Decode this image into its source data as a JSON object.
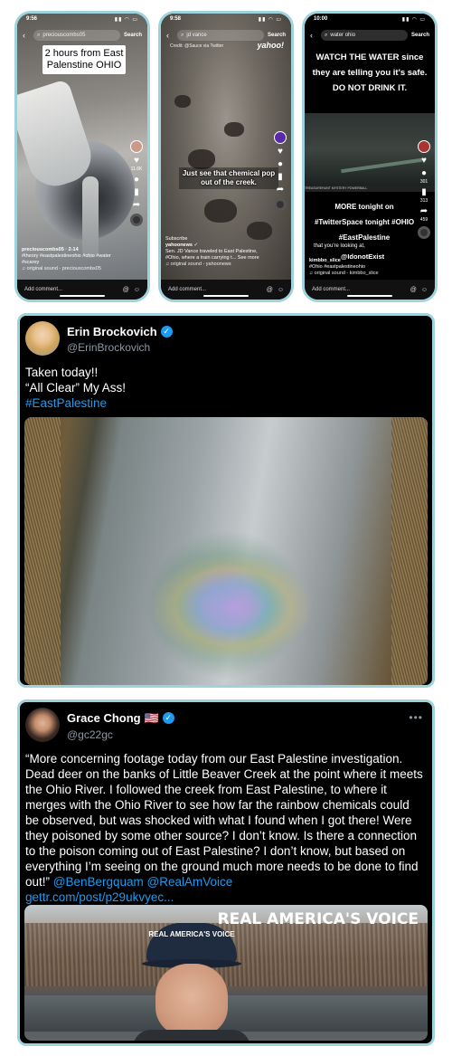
{
  "phones": [
    {
      "time": "9:56",
      "search": {
        "query": "preciouscombs05",
        "button": "Search"
      },
      "caption": "2 hours from East Palenstine OHIO",
      "likes": "11.6K",
      "meta": {
        "user": "preciouscombs05 · 2-14",
        "tags": "#theory #eastpalestineohio #ohio #water #scarey",
        "sound": "♫ original sound - preciouscombs05"
      },
      "comment_placeholder": "Add comment..."
    },
    {
      "time": "9:58",
      "search": {
        "query": "jd vance",
        "button": "Search"
      },
      "sub": "Credit: @Sauce via Twitter",
      "brand": "yahoo!",
      "caption": "Just see that chemical pop out of the creek.",
      "meta": {
        "subscribe": "Subscribe",
        "user": "yahoonews ✓",
        "tags": "Sen. JD Vance traveled to East Palestine, #Ohio, where a train carrying t... See more",
        "sound": "♫ original sound - yahoonews"
      },
      "comment_placeholder": "Add comment..."
    },
    {
      "time": "10:00",
      "search": {
        "query": "water ohio",
        "button": "Search"
      },
      "top_caption": "WATCH THE WATER since they are telling you it's safe. DO NOT DRINK IT.",
      "ticker": "TREASUREHUNT  MYSTERY  POWERBALL",
      "bottom_caption": "MORE tonight on #TwitterSpace tonight #OHIO #EastPalestine",
      "overlay": "that you're looking at,",
      "overlay2": "@IdonotExist",
      "counts": [
        "301",
        "313",
        "459"
      ],
      "meta": {
        "user": "kimbbo_slice",
        "tags": "#Ohio #eastpalestineohio",
        "sound": "♫ original sound - kimbbo_slice"
      },
      "comment_placeholder": "Add comment..."
    }
  ],
  "tweet1": {
    "name": "Erin Brockovich",
    "handle": "@ErinBrockovich",
    "line1": "Taken today!!",
    "line2": "“All Clear” My Ass!",
    "hashtag": "#EastPalestine"
  },
  "tweet2": {
    "name": "Grace Chong",
    "flag": "🇺🇸",
    "handle": "@gc22gc",
    "text": "“More concerning footage today from our East Palestine investigation. Dead deer on the banks of Little Beaver Creek at the point where it meets the Ohio River. I followed the creek from East Palestine, to where it merges with the Ohio River to see how far the rainbow chemicals could be observed, but was shocked with what I found when I got there! Were they poisoned by some other source? I don’t know. Is there a connection to the poison coming out of East Palestine? I don’t know, but based on everything I’m seeing on the ground much more needs to be done to find out!”",
    "mentions": " @BenBergquam @RealAmVoice",
    "link": "gettr.com/post/p29ukvyec...",
    "hat_text": "REAL AMERICA'S VOICE",
    "watermark": "REAL AMERICA'S VOICE"
  },
  "colors": {
    "accent": "#1d9bf0",
    "border": "#9fd3dc",
    "tweet_bg": "#000000"
  }
}
